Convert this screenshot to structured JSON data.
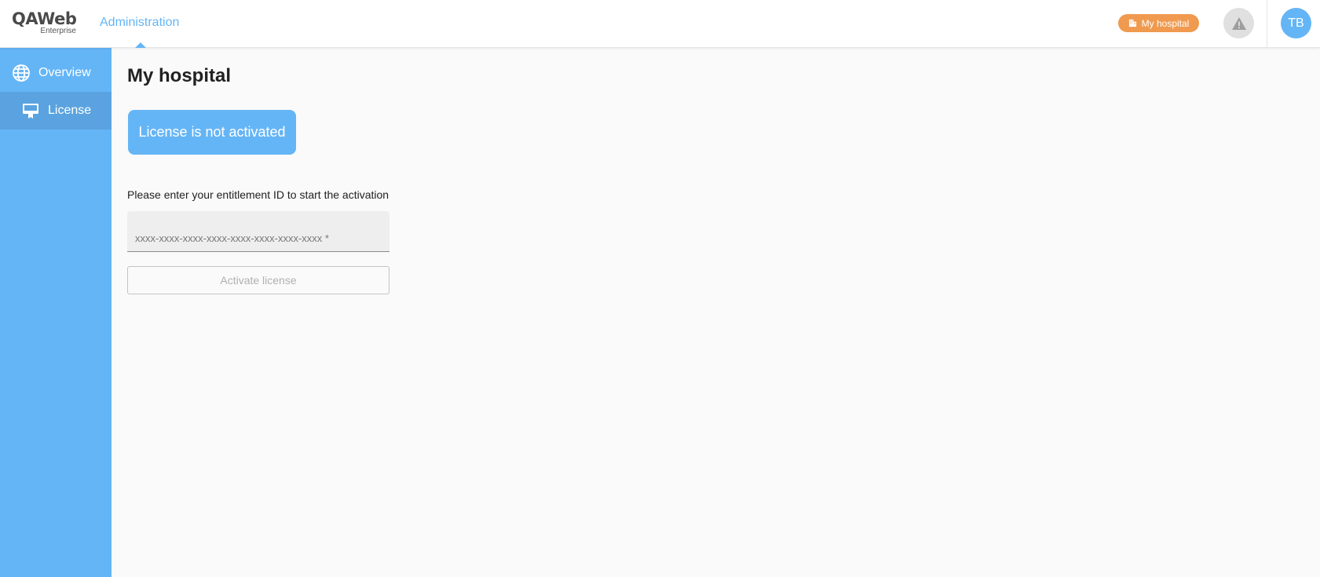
{
  "header": {
    "logo_main": "QAWeb",
    "logo_sub": "Enterprise",
    "nav_label": "Administration",
    "hospital_chip": "My hospital",
    "avatar_initials": "TB",
    "colors": {
      "accent": "#64b5f6",
      "chip": "#ef9a4f"
    }
  },
  "sidebar": {
    "items": [
      {
        "label": "Overview",
        "icon": "globe-icon",
        "active": false
      },
      {
        "label": "License",
        "icon": "license-certificate-icon",
        "active": true
      }
    ]
  },
  "main": {
    "title": "My hospital",
    "status": "License is not activated",
    "prompt": "Please enter your entitlement ID to start the activation",
    "entitlement_input": {
      "placeholder": "xxxx-xxxx-xxxx-xxxx-xxxx-xxxx-xxxx-xxxx *",
      "value": ""
    },
    "activate_button": "Activate license"
  }
}
